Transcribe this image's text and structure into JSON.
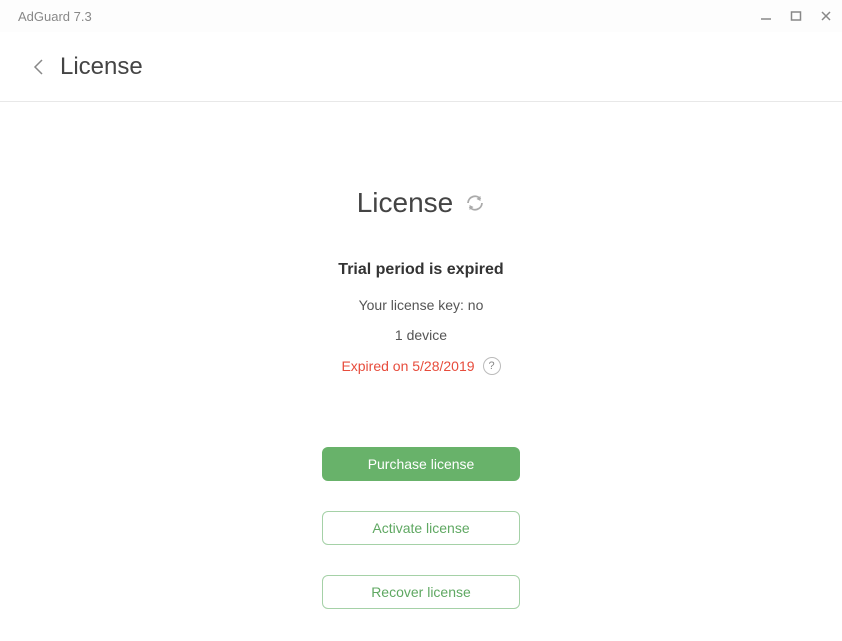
{
  "titlebar": {
    "title": "AdGuard 7.3"
  },
  "header": {
    "title": "License"
  },
  "main": {
    "heading": "License",
    "status": "Trial period is expired",
    "license_key": "Your license key: no",
    "devices": "1 device",
    "expired": "Expired on 5/28/2019",
    "help_symbol": "?"
  },
  "buttons": {
    "purchase": "Purchase license",
    "activate": "Activate license",
    "recover": "Recover license"
  }
}
